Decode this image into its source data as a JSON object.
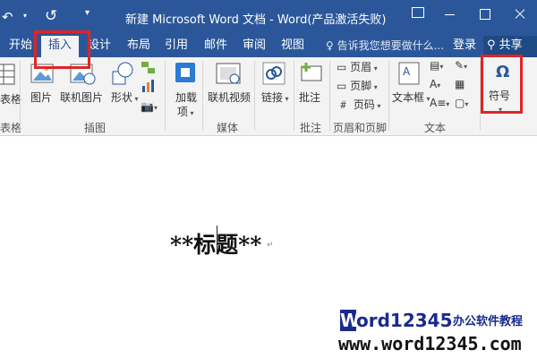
{
  "titlebar": {
    "title": "新建 Microsoft Word 文档 - Word(产品激活失败)",
    "undo_glyph": "↶",
    "redo_glyph": "↺",
    "qat_glyph": "▾",
    "bg_color": "#2b579a"
  },
  "tabs": [
    {
      "label": "开始"
    },
    {
      "label": "插入",
      "active": true
    },
    {
      "label": "设计"
    },
    {
      "label": "布局"
    },
    {
      "label": "引用"
    },
    {
      "label": "邮件"
    },
    {
      "label": "审阅"
    },
    {
      "label": "视图"
    }
  ],
  "tell_me": "告诉我您想要做什么...",
  "signin": "登录",
  "share": "共享",
  "ribbon": {
    "table_label": "表格",
    "table_group": "表格",
    "pictures": "图片",
    "online_pictures": "联机图片",
    "shapes": "形状",
    "illustrations_group": "插图",
    "addins": "加载",
    "addins2": "项",
    "online_video": "联机视频",
    "media_group": "媒体",
    "links": "链接",
    "comment": "批注",
    "comment_group": "批注",
    "header": "页眉",
    "footer": "页脚",
    "page_number": "页码",
    "header_footer_group": "页眉和页脚",
    "textbox": "文本框",
    "text_group": "文本",
    "symbol": "符号",
    "symbol_icon": "Ω"
  },
  "document": {
    "text": "**标题**",
    "para_mark": "↵"
  },
  "watermark": {
    "w": "W",
    "rest": "ord12345",
    "sub": "办公软件教程",
    "url": "www.word12345.com"
  },
  "colors": {
    "accent": "#2b579a",
    "highlight": "#e12424"
  }
}
